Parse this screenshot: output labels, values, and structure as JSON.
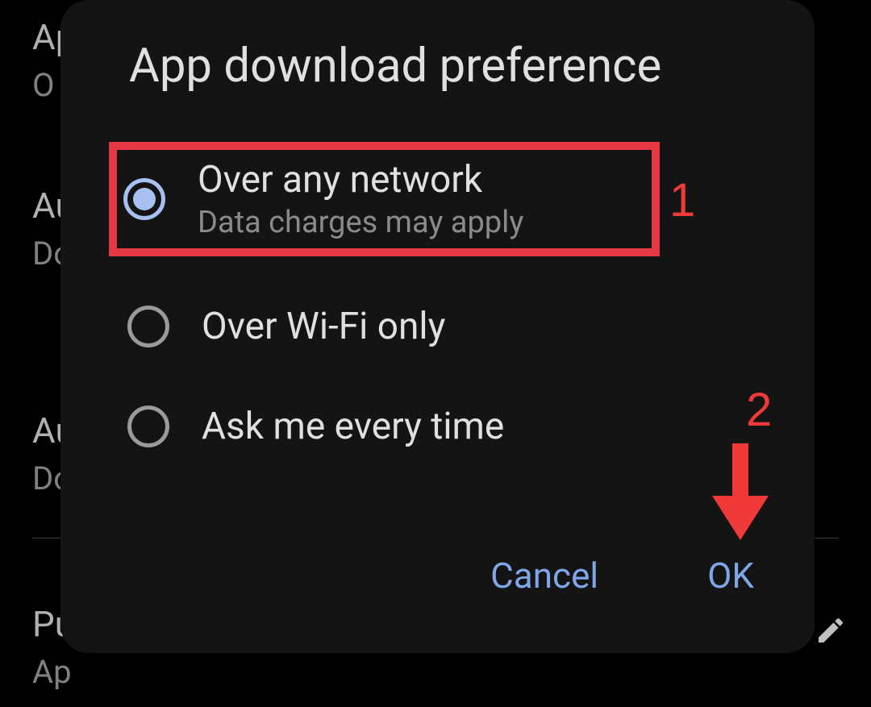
{
  "background": {
    "item1_title": "Ap",
    "item1_sub": "O",
    "item2_title": "Au",
    "item2_sub": "Do",
    "item3_title": "Au",
    "item3_sub": "Do",
    "item4_title": "Pu",
    "item4_sub": "Ap"
  },
  "dialog": {
    "title": "App download preference",
    "options": [
      {
        "label": "Over any network",
        "sub": "Data charges may apply",
        "selected": true
      },
      {
        "label": "Over Wi-Fi only",
        "sub": "",
        "selected": false
      },
      {
        "label": "Ask me every time",
        "sub": "",
        "selected": false
      }
    ],
    "cancel_label": "Cancel",
    "ok_label": "OK"
  },
  "annotations": {
    "label1": "1",
    "label2": "2",
    "colors": {
      "highlight_border": "#e63946",
      "annotation_text": "#f03a3a",
      "accent_radio": "#a7c0f2",
      "accent_button": "#7ea6e8"
    }
  }
}
